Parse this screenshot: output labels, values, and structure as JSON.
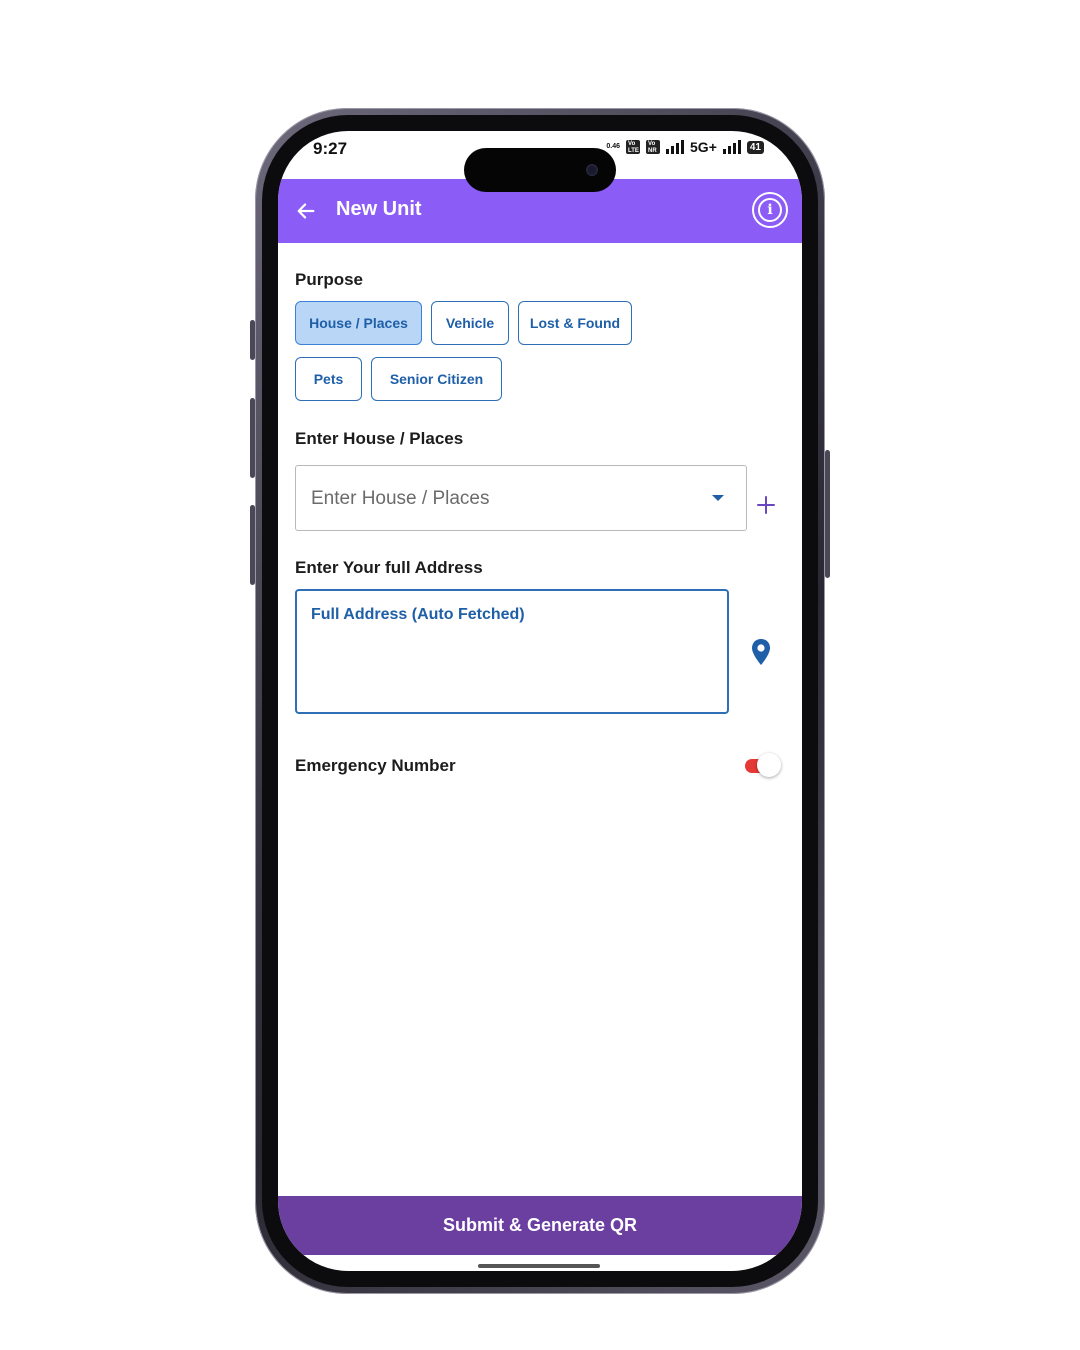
{
  "status_bar": {
    "time": "9:27",
    "speed": "0.46",
    "chip1": "Vo LTE",
    "chip2": "Vo NR",
    "network": "5G+",
    "battery": "41"
  },
  "header": {
    "title": "New Unit",
    "back_icon": "arrow-left-icon",
    "info_icon": "info-icon",
    "background": "#8b5cf6"
  },
  "purpose": {
    "label": "Purpose",
    "selected": "House / Places",
    "options": [
      "House / Places",
      "Vehicle",
      "Lost & Found",
      "Pets",
      "Senior Citizen"
    ]
  },
  "house_places": {
    "label": "Enter House / Places",
    "placeholder": "Enter House / Places",
    "add_icon": "plus-icon"
  },
  "address": {
    "label": "Enter Your full Address",
    "placeholder": "Full Address (Auto Fetched)",
    "location_icon": "map-pin-icon"
  },
  "emergency": {
    "label": "Emergency Number",
    "toggle_on": false,
    "toggle_color": "#e53935"
  },
  "footer": {
    "submit_label": "Submit & Generate QR",
    "background": "#6b3fa0"
  }
}
